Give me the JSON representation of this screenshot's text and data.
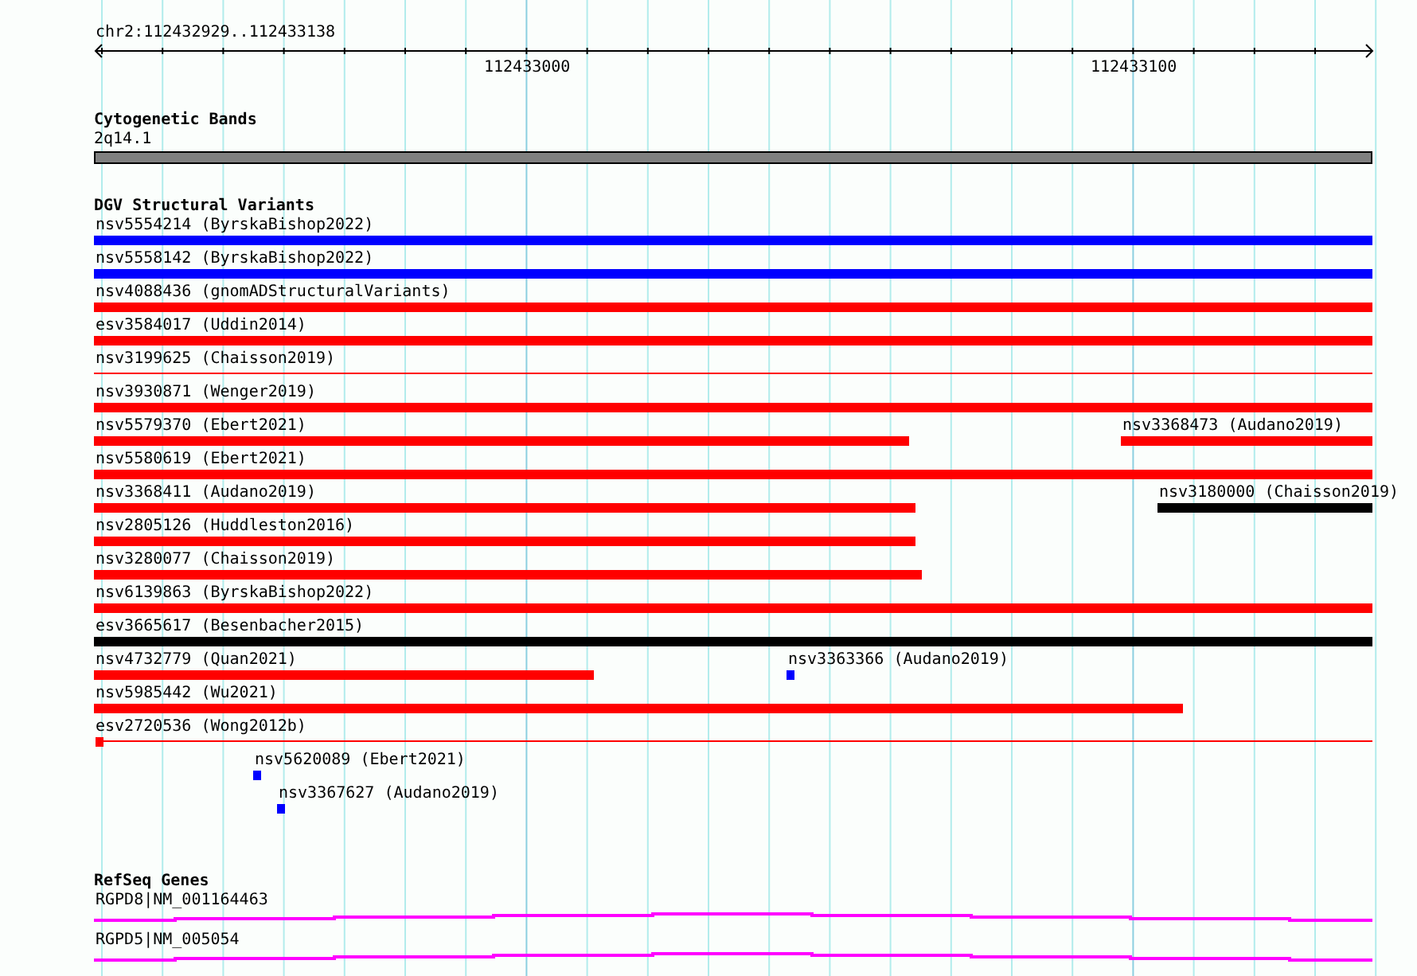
{
  "ruler": {
    "region": "chr2:112432929..112433138",
    "ticks": [
      "112433000",
      "112433100"
    ]
  },
  "cytogenetic_bands": {
    "title": "Cytogenetic Bands",
    "band": "2q14.1"
  },
  "dgv": {
    "title": "DGV Structural Variants",
    "rows": [
      {
        "features": [
          {
            "label": "nsv5554214 (ByrskaBishop2022)",
            "kind": "bar",
            "color": "#0000ff"
          }
        ]
      },
      {
        "features": [
          {
            "label": "nsv5558142 (ByrskaBishop2022)",
            "kind": "bar",
            "color": "#0000ff"
          }
        ]
      },
      {
        "features": [
          {
            "label": "nsv4088436 (gnomADStructuralVariants)",
            "kind": "bar",
            "color": "#ff0000"
          }
        ]
      },
      {
        "features": [
          {
            "label": "esv3584017 (Uddin2014)",
            "kind": "bar",
            "color": "#ff0000"
          }
        ]
      },
      {
        "features": [
          {
            "label": "nsv3199625 (Chaisson2019)",
            "kind": "line",
            "color": "#ff0000"
          }
        ]
      },
      {
        "features": [
          {
            "label": "nsv3930871 (Wenger2019)",
            "kind": "bar",
            "color": "#ff0000"
          }
        ]
      },
      {
        "features": [
          {
            "label": "nsv5579370 (Ebert2021)",
            "kind": "bar",
            "color": "#ff0000"
          },
          {
            "label": "nsv3368473 (Audano2019)",
            "kind": "bar",
            "color": "#ff0000"
          }
        ]
      },
      {
        "features": [
          {
            "label": "nsv5580619 (Ebert2021)",
            "kind": "bar",
            "color": "#ff0000"
          }
        ]
      },
      {
        "features": [
          {
            "label": "nsv3368411 (Audano2019)",
            "kind": "bar",
            "color": "#ff0000"
          },
          {
            "label": "nsv3180000 (Chaisson2019)",
            "kind": "bar",
            "color": "#000000"
          }
        ]
      },
      {
        "features": [
          {
            "label": "nsv2805126 (Huddleston2016)",
            "kind": "bar",
            "color": "#ff0000"
          }
        ]
      },
      {
        "features": [
          {
            "label": "nsv3280077 (Chaisson2019)",
            "kind": "bar",
            "color": "#ff0000"
          }
        ]
      },
      {
        "features": [
          {
            "label": "nsv6139863 (ByrskaBishop2022)",
            "kind": "bar",
            "color": "#ff0000"
          }
        ]
      },
      {
        "features": [
          {
            "label": "esv3665617 (Besenbacher2015)",
            "kind": "bar",
            "color": "#000000"
          }
        ]
      },
      {
        "features": [
          {
            "label": "nsv4732779 (Quan2021)",
            "kind": "bar",
            "color": "#ff0000"
          },
          {
            "label": "nsv3363366 (Audano2019)",
            "kind": "point",
            "color": "#0000ff"
          }
        ]
      },
      {
        "features": [
          {
            "label": "nsv5985442 (Wu2021)",
            "kind": "bar",
            "color": "#ff0000"
          }
        ]
      },
      {
        "features": [
          {
            "label": "esv2720536 (Wong2012b)",
            "kind": "marked-line",
            "color": "#ff0000"
          }
        ]
      },
      {
        "features": [
          {
            "label": "nsv5620089 (Ebert2021)",
            "kind": "point",
            "color": "#0000ff"
          }
        ]
      },
      {
        "features": [
          {
            "label": "nsv3367627 (Audano2019)",
            "kind": "point",
            "color": "#0000ff"
          }
        ]
      }
    ]
  },
  "refseq": {
    "title": "RefSeq Genes",
    "genes": [
      "RGPD8|NM_001164463",
      "RGPD5|NM_005054"
    ]
  }
}
